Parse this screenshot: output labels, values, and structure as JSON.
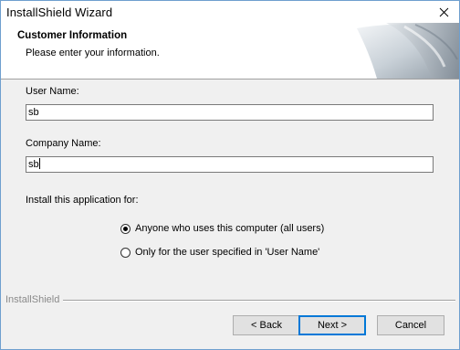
{
  "window": {
    "title": "InstallShield Wizard"
  },
  "header": {
    "title": "Customer Information",
    "subtitle": "Please enter your information."
  },
  "form": {
    "user_name_label": "User Name:",
    "user_name_value": "sb",
    "company_name_label": "Company Name:",
    "company_name_value": "sb",
    "install_for_label": "Install this application for:",
    "options": [
      {
        "label": "Anyone who uses this computer (all users)",
        "selected": true
      },
      {
        "label": "Only for the user specified in 'User Name'",
        "selected": false
      }
    ]
  },
  "footer": {
    "brand": "InstallShield",
    "back_label": "< Back",
    "next_label": "Next >",
    "cancel_label": "Cancel"
  },
  "colors": {
    "window_border": "#6f9fcf",
    "dialog_bg": "#f0f0f0",
    "default_button_border": "#0078d7"
  }
}
